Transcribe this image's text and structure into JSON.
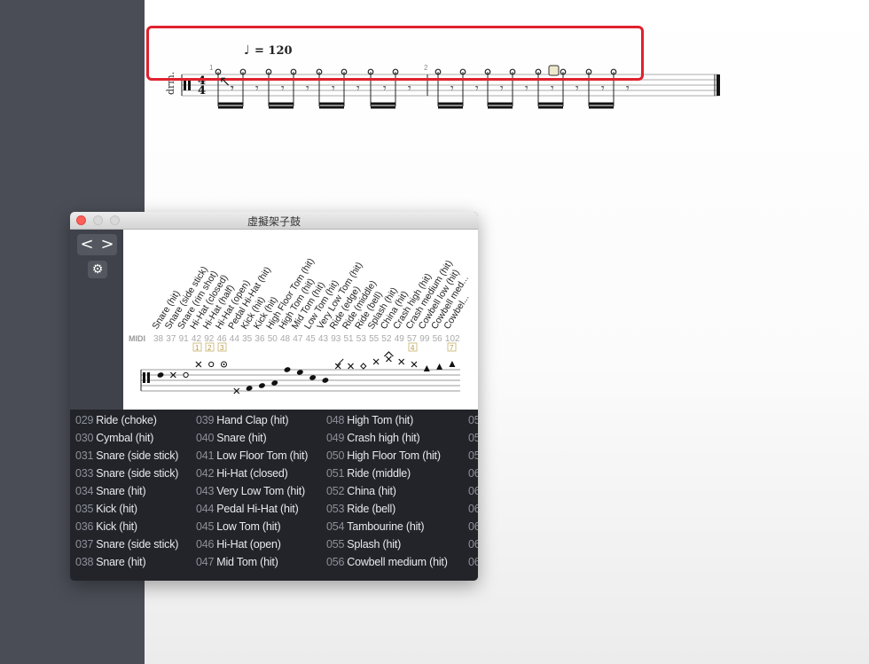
{
  "score": {
    "tempo_text": "= 120",
    "instrument_label": "drm.",
    "time_signature_top": "4",
    "time_signature_bottom": "4",
    "measure_numbers": [
      "1",
      "2"
    ]
  },
  "window": {
    "title": "虛擬架子鼓",
    "nav_prev": "<",
    "nav_next": ">",
    "settings_icon": "gear-icon",
    "midi_label": "MIDI",
    "instrument_headers": [
      "Snare (hit)",
      "Snare (side stick)",
      "Snare (rim shot)",
      "Hi-Hat (closed)",
      "Hi-Hat (half)",
      "Hi-Hat (open)",
      "Pedal Hi-Hat (hit)",
      "Kick (hit)",
      "Kick (hit)",
      "High Floor Tom (hit)",
      "High Tom (hit)",
      "Mid Tom (hit)",
      "Low Tom (hit)",
      "Very Low Tom (hit)",
      "Ride (edge)",
      "Ride (middle)",
      "Ride (bell)",
      "Splash (hit)",
      "China (hit)",
      "Crash high (hit)",
      "Crash medium (hit)",
      "Cowbell low (hit)",
      "Cowbell med...",
      "Cowbel..."
    ],
    "midi_numbers": [
      "38",
      "37",
      "91",
      "42",
      "92",
      "46",
      "44",
      "35",
      "36",
      "50",
      "48",
      "47",
      "45",
      "43",
      "93",
      "51",
      "53",
      "55",
      "52",
      "49",
      "57",
      "99",
      "56",
      "102"
    ],
    "finger_markers": [
      "1",
      "2",
      "3",
      "4",
      "7"
    ],
    "list_columns": [
      [
        {
          "num": "029",
          "name": "Ride (choke)"
        },
        {
          "num": "030",
          "name": "Cymbal (hit)"
        },
        {
          "num": "031",
          "name": "Snare (side stick)"
        },
        {
          "num": "033",
          "name": "Snare (side stick)"
        },
        {
          "num": "034",
          "name": "Snare (hit)"
        },
        {
          "num": "035",
          "name": "Kick (hit)"
        },
        {
          "num": "036",
          "name": "Kick (hit)"
        },
        {
          "num": "037",
          "name": "Snare (side stick)"
        },
        {
          "num": "038",
          "name": "Snare (hit)"
        }
      ],
      [
        {
          "num": "039",
          "name": "Hand Clap (hit)"
        },
        {
          "num": "040",
          "name": "Snare (hit)"
        },
        {
          "num": "041",
          "name": "Low Floor Tom (hit)"
        },
        {
          "num": "042",
          "name": "Hi-Hat (closed)"
        },
        {
          "num": "043",
          "name": "Very Low Tom (hit)"
        },
        {
          "num": "044",
          "name": "Pedal Hi-Hat (hit)"
        },
        {
          "num": "045",
          "name": "Low Tom (hit)"
        },
        {
          "num": "046",
          "name": "Hi-Hat (open)"
        },
        {
          "num": "047",
          "name": "Mid Tom (hit)"
        }
      ],
      [
        {
          "num": "048",
          "name": "High Tom (hit)"
        },
        {
          "num": "049",
          "name": "Crash high (hit)"
        },
        {
          "num": "050",
          "name": "High Floor Tom (hit)"
        },
        {
          "num": "051",
          "name": "Ride (middle)"
        },
        {
          "num": "052",
          "name": "China (hit)"
        },
        {
          "num": "053",
          "name": "Ride (bell)"
        },
        {
          "num": "054",
          "name": "Tambourine (hit)"
        },
        {
          "num": "055",
          "name": "Splash (hit)"
        },
        {
          "num": "056",
          "name": "Cowbell medium (hit)"
        }
      ]
    ],
    "list_col4_clipped": [
      "05",
      "05",
      "05",
      "06",
      "06",
      "06",
      "06",
      "06",
      "06"
    ]
  }
}
